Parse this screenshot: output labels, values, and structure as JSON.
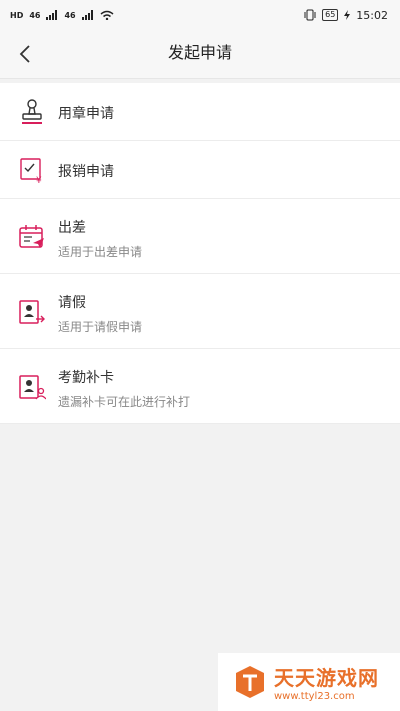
{
  "status_bar": {
    "left_labels": [
      "HD",
      "46",
      "46"
    ],
    "battery": "65",
    "time": "15:02"
  },
  "nav": {
    "title": "发起申请",
    "back_icon": "chevron-left-icon"
  },
  "items": [
    {
      "title": "用章申请",
      "subtitle": "",
      "icon": "stamp-icon"
    },
    {
      "title": "报销申请",
      "subtitle": "",
      "icon": "reimbursement-icon"
    },
    {
      "title": "出差",
      "subtitle": "适用于出差申请",
      "icon": "calendar-plane-icon"
    },
    {
      "title": "请假",
      "subtitle": "适用于请假申请",
      "icon": "leave-icon"
    },
    {
      "title": "考勤补卡",
      "subtitle": "遗漏补卡可在此进行补打",
      "icon": "attendance-card-icon"
    }
  ],
  "watermark": {
    "name": "天天游戏网",
    "url": "www.ttyl23.com"
  },
  "colors": {
    "accent": "#d81e5b",
    "watermark": "#e8702a"
  }
}
